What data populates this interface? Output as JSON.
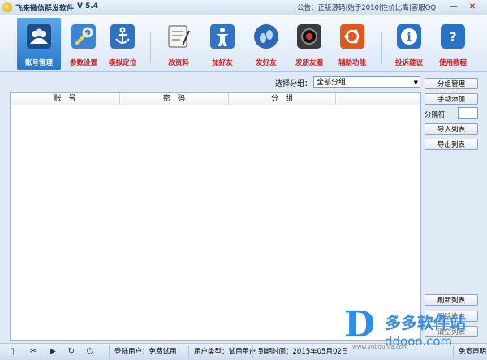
{
  "window": {
    "title": "飞来微信群发软件",
    "version": "V 5.4",
    "announcement": "公告：正版源码|始于2010|性价比高|客服QQ",
    "min": "—",
    "close": "✕"
  },
  "toolbar": [
    {
      "label": "账号管理",
      "icon": "users-icon",
      "color": "#1b4f8a"
    },
    {
      "label": "参数设置",
      "icon": "wrench-icon",
      "color": "#2a6fbf"
    },
    {
      "label": "模拟定位",
      "icon": "anchor-icon",
      "color": "#2a6fbf"
    },
    {
      "label": "改资料",
      "icon": "notepad-icon",
      "color": "#555"
    },
    {
      "label": "加好友",
      "icon": "person-icon",
      "color": "#2a6fbf"
    },
    {
      "label": "发好友",
      "icon": "footprints-icon",
      "color": "#2a6fbf"
    },
    {
      "label": "发朋友圈",
      "icon": "camera-icon",
      "color": "#333"
    },
    {
      "label": "辅助功能",
      "icon": "ubuntu-icon",
      "color": "#e05a1f"
    },
    {
      "label": "投诉建议",
      "icon": "info-icon",
      "color": "#2a6fbf"
    },
    {
      "label": "使用教程",
      "icon": "help-icon",
      "color": "#2a6fbf"
    }
  ],
  "group_select": {
    "label": "选择分组：",
    "value": "全部分组"
  },
  "table": {
    "columns": [
      "账　号",
      "密　码",
      "分　组"
    ]
  },
  "buttons": {
    "group_manage": "分组管理",
    "manual_add": "手动添加",
    "separator_label": "分隔符",
    "separator_value": ",",
    "import_list": "导入列表",
    "export_list": "导出列表",
    "refresh_list": "刷新列表",
    "btn_hidden1": "删除选中",
    "btn_hidden2": "清空列表"
  },
  "status": {
    "login_user": "登陆用户：免费试用",
    "user_type": "用户类型：试用用户",
    "expire": "到期时间：2015年05月02日",
    "disclaimer": "免责声明"
  },
  "watermark": {
    "brand": "多多软件站",
    "url": "ddooo.com",
    "small": "www.yobqunfa.com"
  }
}
